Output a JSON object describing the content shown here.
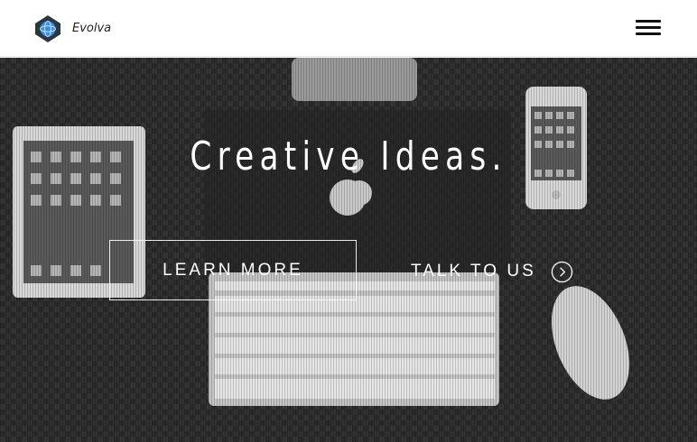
{
  "header": {
    "brand": "Evolva",
    "logo_icon": "globe-badge-icon",
    "menu_icon": "hamburger-menu-icon"
  },
  "hero": {
    "headline": "Creative Ideas.",
    "primary_button": "LEARN MORE",
    "secondary_button": "TALK TO US",
    "secondary_icon": "chevron-right-circle-icon"
  },
  "colors": {
    "header_bg": "#ffffff",
    "hero_bg": "#2e2e2e",
    "text_light": "#ffffff",
    "logo_blue": "#2f7fd0"
  }
}
